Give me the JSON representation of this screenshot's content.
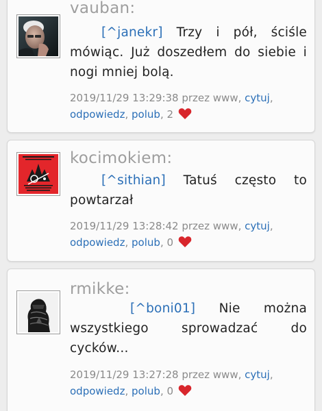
{
  "posts": [
    {
      "username": "vauban:",
      "quote_user": "[^janekr]",
      "text": " Trzy i pół, ściśle mówiąc. Już doszedłem do siebie i nogi mniej bolą.",
      "timestamp": "2019/11/29 13:29:38 przez www,",
      "cite_label": "cytuj",
      "reply_label": "odpowiedz",
      "like_label": "polub",
      "like_count": "2",
      "avatar_icon": "elderly-man-portrait"
    },
    {
      "username": "kocimokiem:",
      "quote_user": "[^sithian]",
      "text": " Tatuś często to powtarzał",
      "timestamp": "2019/11/29 13:28:42 przez www,",
      "cite_label": "cytuj",
      "reply_label": "odpowiedz",
      "like_label": "polub",
      "like_count": "0",
      "avatar_icon": "red-poster-avatar"
    },
    {
      "username": "rmikke:",
      "quote_user": "[^boni01]",
      "text": " Nie można wszystkiego sprowadzać do cycków...",
      "timestamp": "2019/11/29 13:27:28 przez www,",
      "cite_label": "cytuj",
      "reply_label": "odpowiedz",
      "like_label": "polub",
      "like_count": "0",
      "avatar_icon": "dark-figure-avatar"
    }
  ],
  "colors": {
    "link": "#2b6fb7",
    "username": "#9e9e9e",
    "meta": "#8a8a8a",
    "heart": "#d8262c"
  }
}
